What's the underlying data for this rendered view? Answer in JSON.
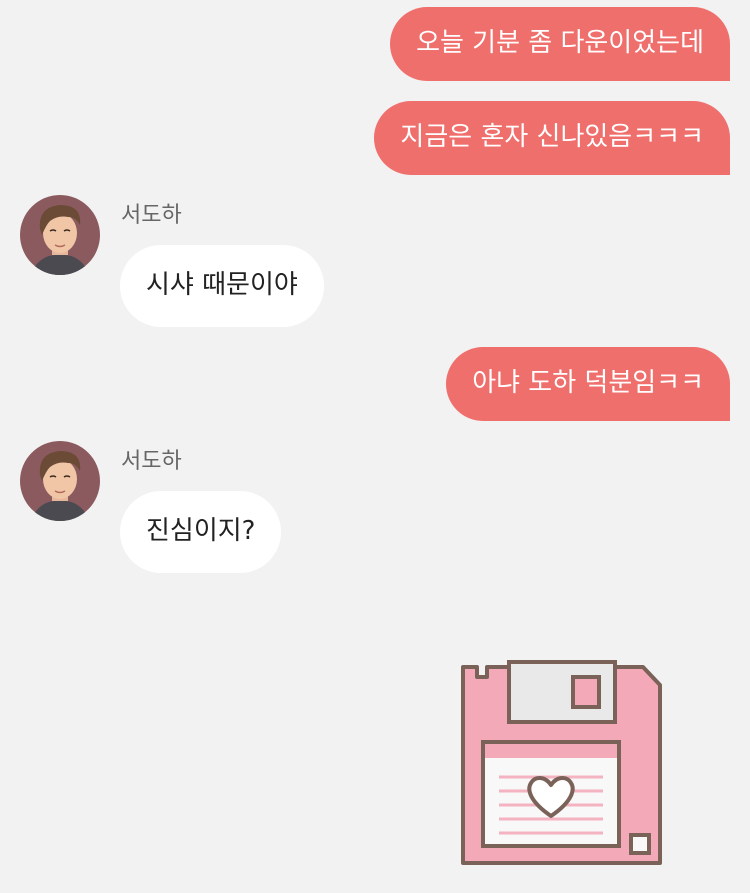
{
  "chat": {
    "messages": [
      {
        "type": "sent",
        "text": "오늘 기분 좀 다운이었는데"
      },
      {
        "type": "sent",
        "text": "지금은 혼자 신나있음ㅋㅋㅋ"
      },
      {
        "type": "received",
        "sender": "서도하",
        "text": "시샤 때문이야"
      },
      {
        "type": "sent",
        "text": "아냐 도하 덕분임ㅋㅋ"
      },
      {
        "type": "received",
        "sender": "서도하",
        "text": "진심이지?"
      }
    ],
    "sticker": {
      "icon": "floppy-disk-heart-icon"
    }
  },
  "colors": {
    "background": "#f2f2f2",
    "sent_bubble": "#ef6f6c",
    "received_bubble": "#ffffff",
    "sticker_pink": "#f4a9b8",
    "sticker_outline": "#7a6259"
  }
}
